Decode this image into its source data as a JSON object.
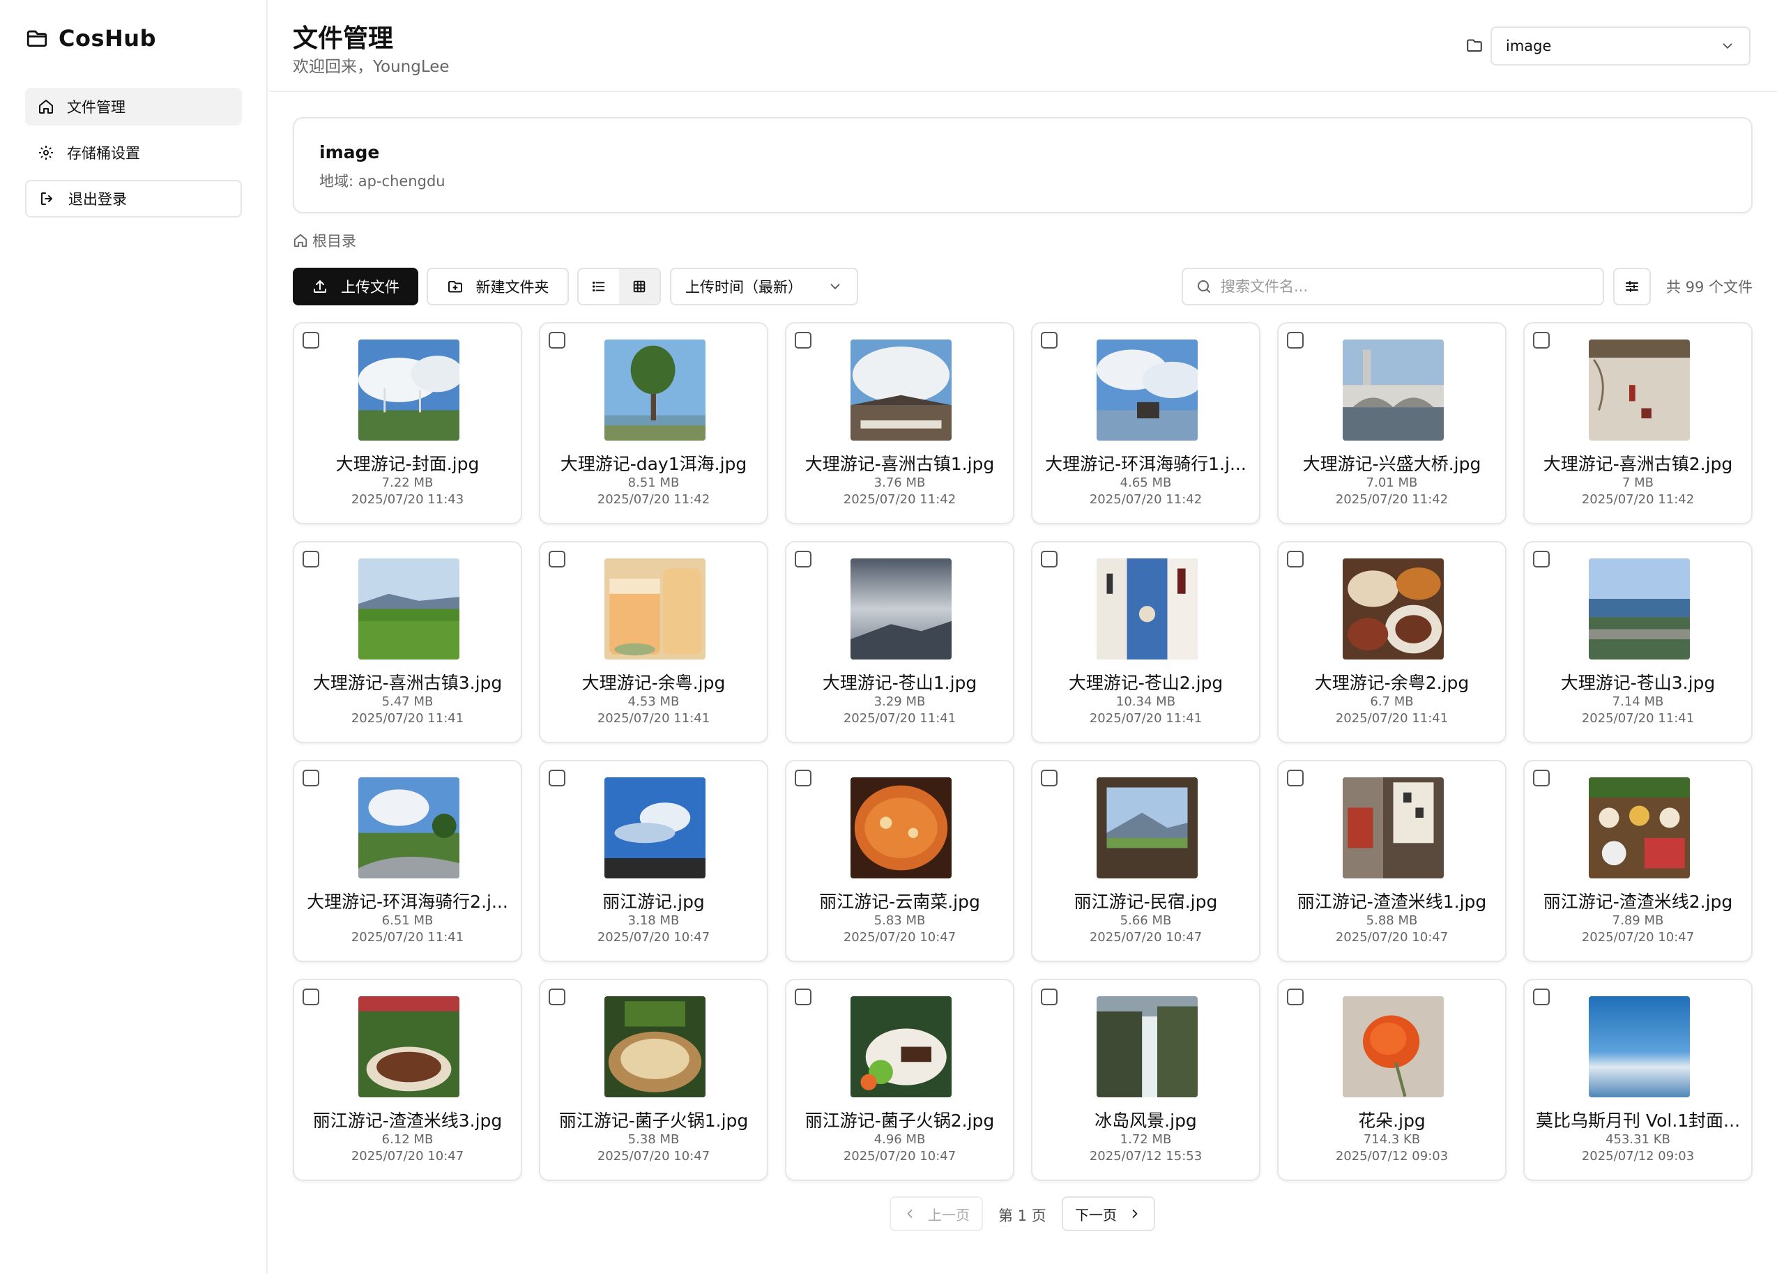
{
  "app": {
    "name": "CosHub"
  },
  "sidebar": {
    "items": [
      {
        "label": "文件管理",
        "icon": "home-icon",
        "active": true
      },
      {
        "label": "存储桶设置",
        "icon": "gear-icon",
        "active": false
      },
      {
        "label": "退出登录",
        "icon": "logout-icon",
        "active": false
      }
    ]
  },
  "header": {
    "title": "文件管理",
    "welcome": "欢迎回来，YoungLee",
    "bucket_select_value": "image"
  },
  "bucket": {
    "name": "image",
    "region": "地域: ap-chengdu"
  },
  "breadcrumb": {
    "root": "根目录"
  },
  "toolbar": {
    "upload_label": "上传文件",
    "new_folder_label": "新建文件夹",
    "sort_value": "上传时间（最新）",
    "search_placeholder": "搜索文件名...",
    "total": "共 99 个文件"
  },
  "files": [
    {
      "name": "大理游记-封面.jpg",
      "size": "7.22 MB",
      "date": "2025/07/20 11:43"
    },
    {
      "name": "大理游记-day1洱海.jpg",
      "size": "8.51 MB",
      "date": "2025/07/20 11:42"
    },
    {
      "name": "大理游记-喜洲古镇1.jpg",
      "size": "3.76 MB",
      "date": "2025/07/20 11:42"
    },
    {
      "name": "大理游记-环洱海骑行1.j...",
      "size": "4.65 MB",
      "date": "2025/07/20 11:42"
    },
    {
      "name": "大理游记-兴盛大桥.jpg",
      "size": "7.01 MB",
      "date": "2025/07/20 11:42"
    },
    {
      "name": "大理游记-喜洲古镇2.jpg",
      "size": "7 MB",
      "date": "2025/07/20 11:42"
    },
    {
      "name": "大理游记-喜洲古镇3.jpg",
      "size": "5.47 MB",
      "date": "2025/07/20 11:41"
    },
    {
      "name": "大理游记-余粤.jpg",
      "size": "4.53 MB",
      "date": "2025/07/20 11:41"
    },
    {
      "name": "大理游记-苍山1.jpg",
      "size": "3.29 MB",
      "date": "2025/07/20 11:41"
    },
    {
      "name": "大理游记-苍山2.jpg",
      "size": "10.34 MB",
      "date": "2025/07/20 11:41"
    },
    {
      "name": "大理游记-余粤2.jpg",
      "size": "6.7 MB",
      "date": "2025/07/20 11:41"
    },
    {
      "name": "大理游记-苍山3.jpg",
      "size": "7.14 MB",
      "date": "2025/07/20 11:41"
    },
    {
      "name": "大理游记-环洱海骑行2.j...",
      "size": "6.51 MB",
      "date": "2025/07/20 11:41"
    },
    {
      "name": "丽江游记.jpg",
      "size": "3.18 MB",
      "date": "2025/07/20 10:47"
    },
    {
      "name": "丽江游记-云南菜.jpg",
      "size": "5.83 MB",
      "date": "2025/07/20 10:47"
    },
    {
      "name": "丽江游记-民宿.jpg",
      "size": "5.66 MB",
      "date": "2025/07/20 10:47"
    },
    {
      "name": "丽江游记-渣渣米线1.jpg",
      "size": "5.88 MB",
      "date": "2025/07/20 10:47"
    },
    {
      "name": "丽江游记-渣渣米线2.jpg",
      "size": "7.89 MB",
      "date": "2025/07/20 10:47"
    },
    {
      "name": "丽江游记-渣渣米线3.jpg",
      "size": "6.12 MB",
      "date": "2025/07/20 10:47"
    },
    {
      "name": "丽江游记-菌子火锅1.jpg",
      "size": "5.38 MB",
      "date": "2025/07/20 10:47"
    },
    {
      "name": "丽江游记-菌子火锅2.jpg",
      "size": "4.96 MB",
      "date": "2025/07/20 10:47"
    },
    {
      "name": "冰岛风景.jpg",
      "size": "1.72 MB",
      "date": "2025/07/12 15:53"
    },
    {
      "name": "花朵.jpg",
      "size": "714.3 KB",
      "date": "2025/07/12 09:03"
    },
    {
      "name": "莫比乌斯月刊 Vol.1封面...",
      "size": "453.31 KB",
      "date": "2025/07/12 09:03"
    }
  ],
  "pagination": {
    "prev": "上一页",
    "info": "第 1 页",
    "next": "下一页"
  }
}
